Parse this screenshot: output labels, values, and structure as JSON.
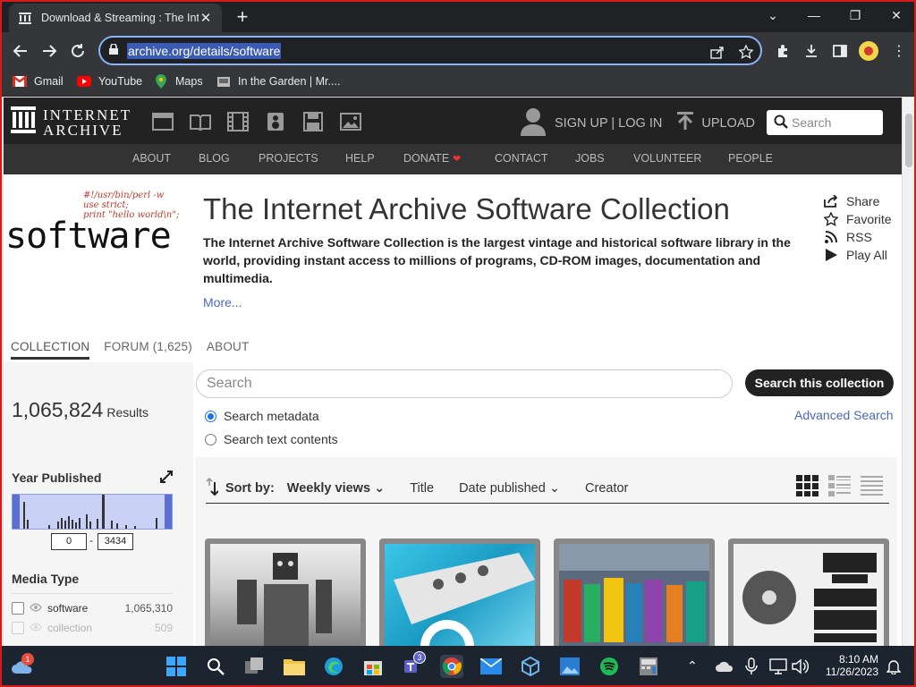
{
  "browser": {
    "tab_title": "Download & Streaming : The Inte",
    "tab_close": "✕",
    "new_tab": "+",
    "url": "archive.org/details/software",
    "bookmarks": [
      {
        "label": "Gmail",
        "icon": "gmail-icon"
      },
      {
        "label": "YouTube",
        "icon": "youtube-icon"
      },
      {
        "label": "Maps",
        "icon": "maps-icon"
      },
      {
        "label": "In the Garden | Mr....",
        "icon": "garden-icon"
      }
    ]
  },
  "ia_header": {
    "logo_line1": "INTERNET",
    "logo_line2": "ARCHIVE",
    "signup": "SIGN UP | LOG IN",
    "upload": "UPLOAD",
    "search_placeholder": "Search"
  },
  "ia_nav": [
    "ABOUT",
    "BLOG",
    "PROJECTS",
    "HELP",
    "DONATE",
    "CONTACT",
    "JOBS",
    "VOLUNTEER",
    "PEOPLE"
  ],
  "collection": {
    "logo_code": "#!/usr/bin/perl -w\nuse strict;\nprint \"hello world\\n\";",
    "logo_word": "software",
    "title": "The Internet Archive Software Collection",
    "description": "The Internet Archive Software Collection is the largest vintage and historical software library in the world, providing instant access to millions of programs, CD-ROM images, documentation and multimedia.",
    "more": "More...",
    "actions": [
      "Share",
      "Favorite",
      "RSS",
      "Play All"
    ],
    "tabs": [
      "COLLECTION",
      "FORUM (1,625)",
      "ABOUT"
    ]
  },
  "sidebar": {
    "result_count": "1,065,824",
    "results_label": "Results",
    "year_title": "Year Published",
    "year_min": "0",
    "year_sep": "-",
    "year_max": "3434",
    "media_title": "Media Type",
    "media": [
      {
        "label": "software",
        "count": "1,065,310"
      },
      {
        "label": "collection",
        "count": "509"
      }
    ]
  },
  "search": {
    "placeholder": "Search",
    "button": "Search this collection",
    "option_metadata": "Search metadata",
    "option_text": "Search text contents",
    "advanced": "Advanced Search"
  },
  "sort": {
    "label": "Sort by:",
    "options": [
      "Weekly views",
      "Title",
      "Date published",
      "Creator"
    ]
  },
  "taskbar": {
    "time": "8:10 AM",
    "date": "11/26/2023",
    "weather_badge": "1",
    "teams_badge": "3"
  }
}
